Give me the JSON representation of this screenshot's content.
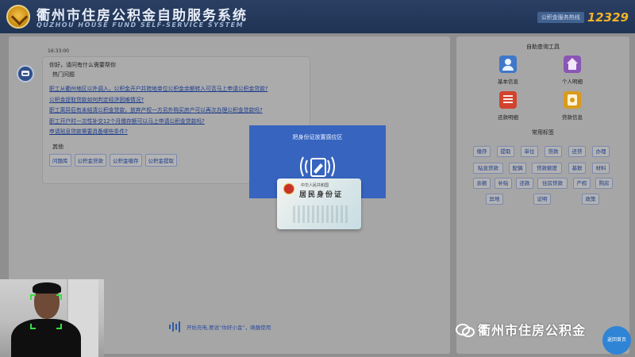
{
  "header": {
    "title_cn": "衢州市住房公积金自助服务系统",
    "title_en": "QUZHOU HOUSE FUND SELF-SERVICE SYSTEM",
    "hotline_label": "公积金服务热线",
    "hotline_number": "12329"
  },
  "chat": {
    "time": "16:33:00",
    "greeting": "你好，请问有什么需要帮你",
    "hot_label": "热门问题",
    "questions": [
      "职工从衢州地区以外调入，公积金开户并跨地单位公积金余额转入可否马上申请公积金贷款?",
      "公积金提取贷款如何判定经济困难情况?",
      "职工离异后有未结清公积金贷款，放弃产权一方另外购买房产可以再次办理公积金贷款吗?",
      "职工开户时一次性补交12个月缴存额可以马上申请公积金贷款吗?",
      "申请贴息贷款需要具备哪些条件?"
    ],
    "other_label": "其他",
    "tags": [
      "问题库",
      "公积金贷款",
      "公积金缴存",
      "公积金提取"
    ],
    "voice_hint": "开始充电,要说“你好小金”，唤醒使用"
  },
  "modal": {
    "title": "把身份证放置感应区",
    "card_line1": "中华人民共和国",
    "card_line2": "居民身份证"
  },
  "right": {
    "tools_title": "自助查询工具",
    "tools": [
      {
        "label": "基本信息",
        "icon": "person-icon"
      },
      {
        "label": "个人明细",
        "icon": "home-icon"
      },
      {
        "label": "还款明细",
        "icon": "list-icon"
      },
      {
        "label": "贷款信息",
        "icon": "coin-icon"
      }
    ],
    "tags_title": "常用标签",
    "chips": [
      "缴存",
      "提取",
      "单位",
      "贷款",
      "还贷",
      "办理",
      "贴息贷款",
      "配偶",
      "贷款额度",
      "基数",
      "材料",
      "余额",
      "补贴",
      "还款",
      "住房贷款",
      "产权",
      "购房",
      "异地",
      "证明",
      "政策"
    ]
  },
  "watermark": "衢州市住房公积金",
  "back_home": "返回首页"
}
